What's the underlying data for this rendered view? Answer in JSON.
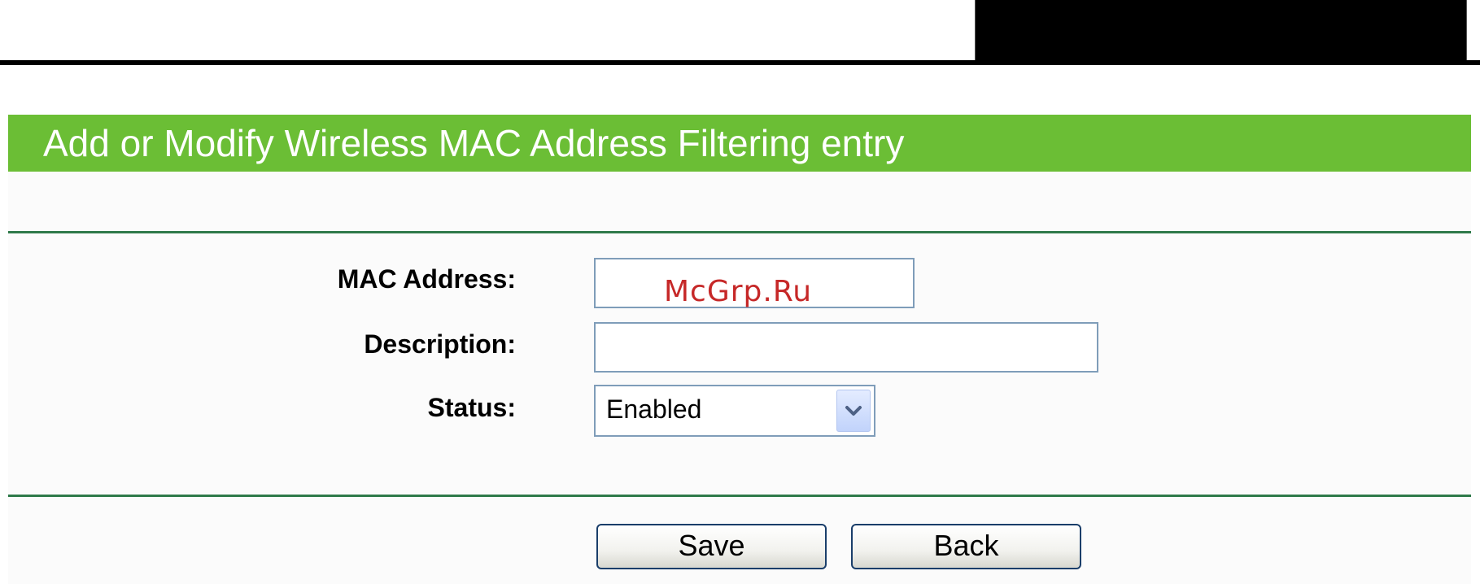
{
  "form": {
    "title": "Add or Modify Wireless MAC Address Filtering entry",
    "mac_label": "MAC Address:",
    "mac_value": "",
    "description_label": "Description:",
    "description_value": "",
    "status_label": "Status:",
    "status_selected": "Enabled"
  },
  "buttons": {
    "save_label": "Save",
    "back_label": "Back"
  },
  "watermark": "McGrp.Ru",
  "colors": {
    "header_bg": "#6bbe35",
    "divider": "#2f7a4a",
    "watermark": "#c62828"
  },
  "icons": {
    "status_dropdown": "chevron-down-icon"
  }
}
